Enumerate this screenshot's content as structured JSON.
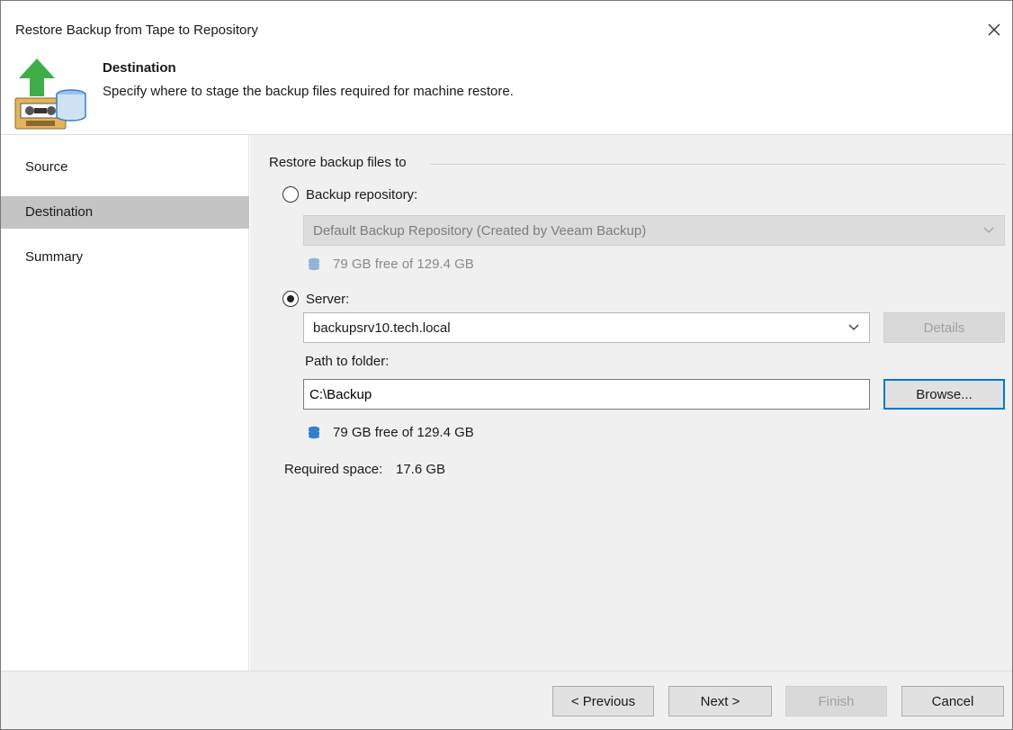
{
  "window": {
    "title": "Restore Backup from Tape to Repository",
    "close_icon": "close-icon"
  },
  "header": {
    "title": "Destination",
    "description": "Specify where to stage the backup files required for machine restore.",
    "icon": "tape-restore-icon"
  },
  "sidebar": {
    "items": [
      {
        "label": "Source",
        "active": false
      },
      {
        "label": "Destination",
        "active": true
      },
      {
        "label": "Summary",
        "active": false
      }
    ]
  },
  "content": {
    "group_label": "Restore backup files to",
    "repository_option": {
      "label": "Backup repository:",
      "checked": false,
      "selected_value": "Default Backup Repository (Created by Veeam Backup)",
      "free_space": "79 GB free of 129.4 GB",
      "enabled": false
    },
    "server_option": {
      "label": "Server:",
      "checked": true,
      "selected_value": "backupsrv10.tech.local",
      "details_label": "Details",
      "path_label": "Path to folder:",
      "path_value": "C:\\Backup",
      "browse_label": "Browse...",
      "free_space": "79 GB free of 129.4 GB"
    },
    "required_space_label": "Required space:",
    "required_space_value": "17.6 GB"
  },
  "footer": {
    "previous_label": "< Previous",
    "next_label": "Next >",
    "finish_label": "Finish",
    "cancel_label": "Cancel"
  },
  "colors": {
    "accent": "#0078d7",
    "icon_green": "#3fae49",
    "db_blue": "#2f7fd1",
    "sidebar_active": "#c4c4c4"
  }
}
